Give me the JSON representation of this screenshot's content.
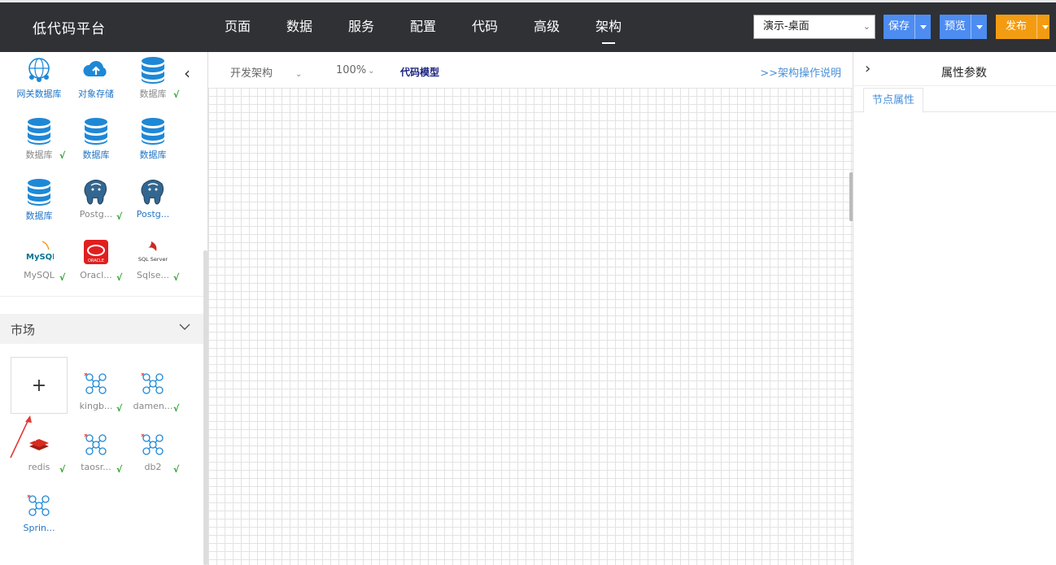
{
  "app": {
    "title": "低代码平台"
  },
  "nav": {
    "items": [
      "页面",
      "数据",
      "服务",
      "配置",
      "代码",
      "高级",
      "架构"
    ],
    "active_index": 6
  },
  "topbar": {
    "env_select": "演示-桌面",
    "save": "保存",
    "preview": "预览",
    "publish": "发布"
  },
  "palette": {
    "items": [
      {
        "label": "网关数据库",
        "icon": "gateway-db-icon",
        "checked": false,
        "highlight": true
      },
      {
        "label": "对象存储",
        "icon": "cloud-upload-icon",
        "checked": false,
        "highlight": true
      },
      {
        "label": "数据库",
        "icon": "database-icon",
        "checked": true,
        "highlight": false
      },
      {
        "label": "数据库",
        "icon": "database-icon",
        "checked": true,
        "highlight": false
      },
      {
        "label": "数据库",
        "icon": "database-icon",
        "checked": false,
        "highlight": true
      },
      {
        "label": "数据库",
        "icon": "database-icon",
        "checked": false,
        "highlight": true
      },
      {
        "label": "数据库",
        "icon": "database-icon",
        "checked": false,
        "highlight": true
      },
      {
        "label": "Postg...",
        "icon": "postgresql-icon",
        "checked": true,
        "highlight": false
      },
      {
        "label": "Postg...",
        "icon": "postgresql-icon",
        "checked": false,
        "highlight": true
      },
      {
        "label": "MySQL",
        "icon": "mysql-icon",
        "checked": true,
        "highlight": false
      },
      {
        "label": "Oracl...",
        "icon": "oracle-icon",
        "checked": true,
        "highlight": false
      },
      {
        "label": "Sqlse...",
        "icon": "sqlserver-icon",
        "checked": true,
        "highlight": false
      }
    ],
    "market": {
      "title": "市场",
      "add_label": "+",
      "items": [
        {
          "label": "kingb...",
          "icon": "node-graph-icon",
          "checked": true,
          "highlight": false
        },
        {
          "label": "damen...",
          "icon": "node-graph-icon",
          "checked": true,
          "highlight": false
        },
        {
          "label": "redis",
          "icon": "redis-icon",
          "checked": true,
          "highlight": false
        },
        {
          "label": "taosr...",
          "icon": "node-graph-icon",
          "checked": true,
          "highlight": false
        },
        {
          "label": "db2",
          "icon": "node-graph-icon",
          "checked": true,
          "highlight": false
        },
        {
          "label": "Sprin...",
          "icon": "node-graph-icon",
          "checked": false,
          "highlight": true
        }
      ]
    },
    "check_mark": "√",
    "icon_texts": {
      "mysql": "MySQL",
      "oracle": "ORACLE",
      "sqlserver": "SQL Server"
    }
  },
  "toolbar": {
    "mode_select": "开发架构",
    "zoom_select": "100%",
    "code_model": "代码模型",
    "help_link": ">>架构操作说明"
  },
  "right_panel": {
    "title": "属性参数",
    "tab": "节点属性"
  },
  "colors": {
    "topbar": "#2f3135",
    "primary_blue": "#4d8cf0",
    "publish_orange": "#f39c12",
    "db_blue": "#1e88d6",
    "annotation_red": "#e53935"
  }
}
